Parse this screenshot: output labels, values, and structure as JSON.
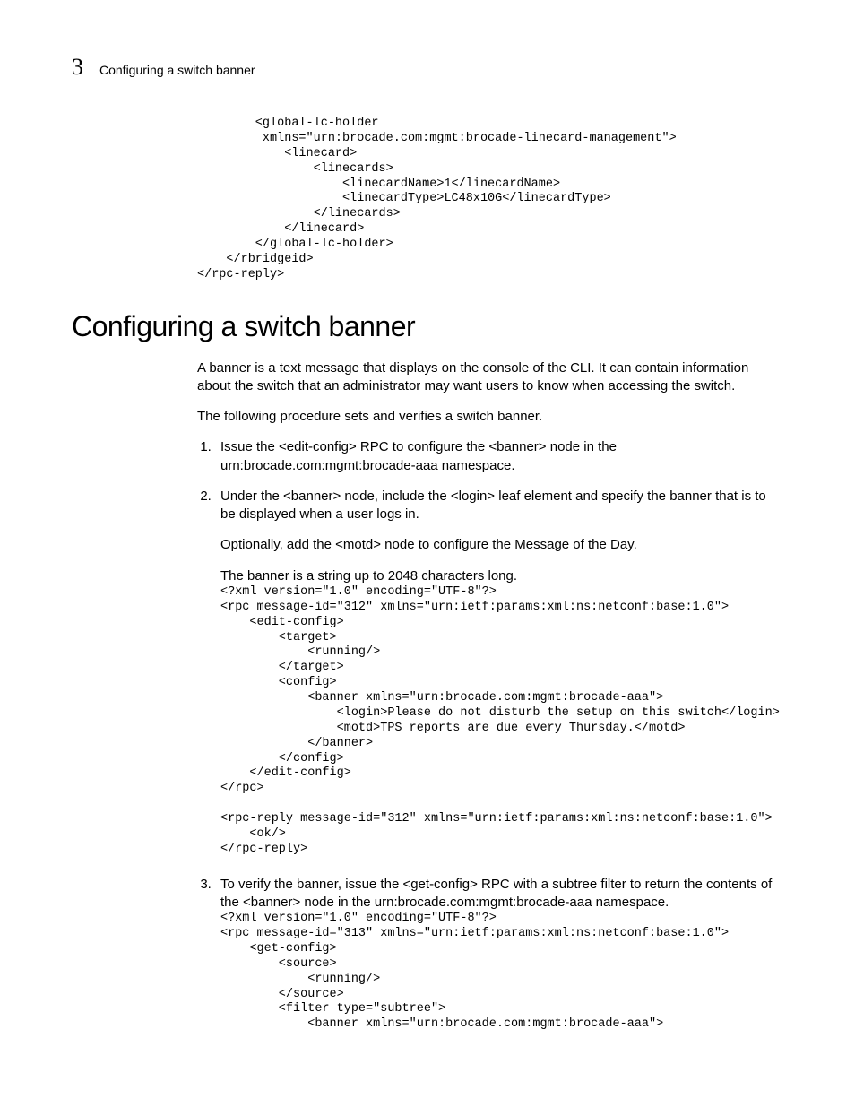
{
  "header": {
    "chapter": "3",
    "title": "Configuring a switch banner"
  },
  "codeblock1": "        <global-lc-holder\n         xmlns=\"urn:brocade.com:mgmt:brocade-linecard-management\">\n            <linecard>\n                <linecards>\n                    <linecardName>1</linecardName>\n                    <linecardType>LC48x10G</linecardType>\n                </linecards>\n            </linecard>\n        </global-lc-holder>\n    </rbridgeid>\n</rpc-reply>",
  "sectionTitle": "Configuring a switch banner",
  "intro1": "A banner is a text message that displays on the console of the CLI. It can contain information about the switch that an administrator may want users to know when accessing the switch.",
  "intro2": "The following procedure sets and verifies a switch banner.",
  "steps": {
    "s1": "Issue the <edit-config> RPC to configure the <banner> node in the urn:brocade.com:mgmt:brocade-aaa namespace.",
    "s2": "Under the <banner> node, include the <login> leaf element and specify the banner that is to be displayed when a user logs in.",
    "s2p1": "Optionally, add the <motd> node to configure the Message of the Day.",
    "s2p2": "The banner is a string up to 2048 characters long.",
    "s3": "To verify the banner, issue the <get-config> RPC with a subtree filter to return the contents of the <banner> node in the urn:brocade.com:mgmt:brocade-aaa namespace."
  },
  "codeblock2": "<?xml version=\"1.0\" encoding=\"UTF-8\"?>\n<rpc message-id=\"312\" xmlns=\"urn:ietf:params:xml:ns:netconf:base:1.0\">\n    <edit-config>\n        <target>\n            <running/>\n        </target>\n        <config>\n            <banner xmlns=\"urn:brocade.com:mgmt:brocade-aaa\">\n                <login>Please do not disturb the setup on this switch</login>\n                <motd>TPS reports are due every Thursday.</motd>\n            </banner>\n        </config>\n    </edit-config>\n</rpc>\n\n<rpc-reply message-id=\"312\" xmlns=\"urn:ietf:params:xml:ns:netconf:base:1.0\">\n    <ok/>\n</rpc-reply>",
  "codeblock3": "<?xml version=\"1.0\" encoding=\"UTF-8\"?>\n<rpc message-id=\"313\" xmlns=\"urn:ietf:params:xml:ns:netconf:base:1.0\">\n    <get-config>\n        <source>\n            <running/>\n        </source>\n        <filter type=\"subtree\">\n            <banner xmlns=\"urn:brocade.com:mgmt:brocade-aaa\">"
}
